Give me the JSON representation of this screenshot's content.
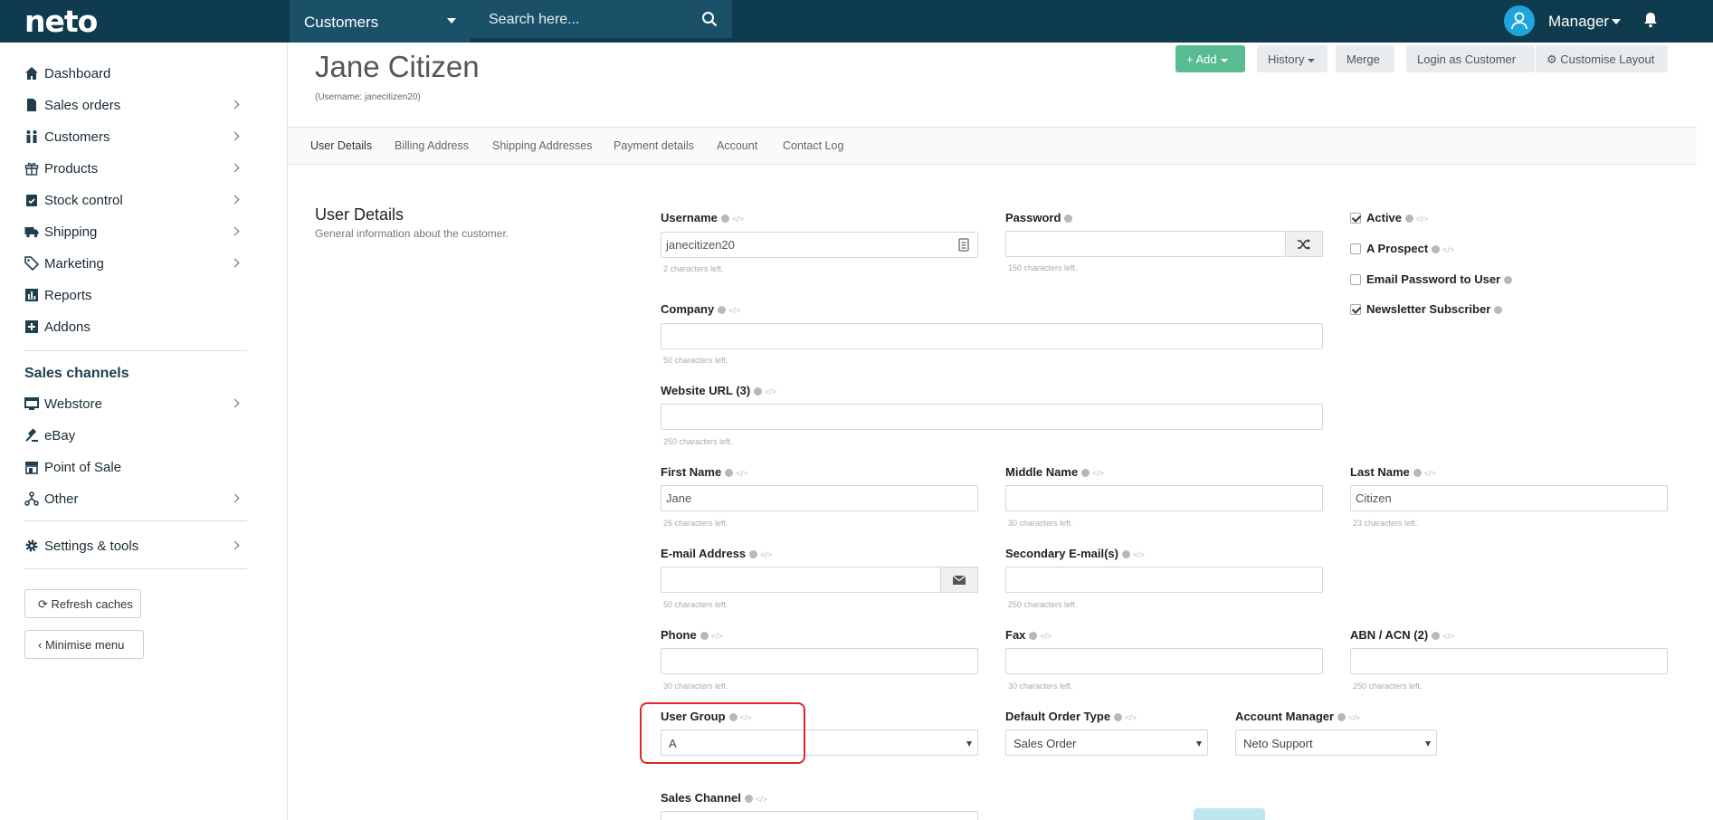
{
  "topbar": {
    "logo": "neto",
    "entity": "Customers",
    "search_placeholder": "Search here...",
    "user": "Manager"
  },
  "sidebar": {
    "items": [
      {
        "label": "Dashboard",
        "icon": "home-icon"
      },
      {
        "label": "Sales orders",
        "icon": "document-icon"
      },
      {
        "label": "Customers",
        "icon": "people-icon"
      },
      {
        "label": "Products",
        "icon": "gift-icon"
      },
      {
        "label": "Stock control",
        "icon": "clipboard-icon"
      },
      {
        "label": "Shipping",
        "icon": "truck-icon"
      },
      {
        "label": "Marketing",
        "icon": "tag-icon"
      },
      {
        "label": "Reports",
        "icon": "bar-chart-icon"
      },
      {
        "label": "Addons",
        "icon": "plus-square-icon"
      }
    ],
    "channels_title": "Sales channels",
    "channels": [
      {
        "label": "Webstore",
        "icon": "monitor-icon"
      },
      {
        "label": "eBay",
        "icon": "gavel-icon"
      },
      {
        "label": "Point of Sale",
        "icon": "store-icon"
      },
      {
        "label": "Other",
        "icon": "fork-icon"
      }
    ],
    "settings": "Settings & tools",
    "refresh": "Refresh caches",
    "minimise": "Minimise menu"
  },
  "header": {
    "title": "Jane Citizen",
    "subtitle": "(Username: janecitizen20)",
    "add": "Add",
    "history": "History",
    "merge": "Merge",
    "login_as": "Login as Customer",
    "customise": "Customise Layout"
  },
  "tabs": [
    "User Details",
    "Billing Address",
    "Shipping Addresses",
    "Payment details",
    "Account",
    "Contact Log"
  ],
  "form": {
    "section_title": "User Details",
    "section_desc": "General information about the customer.",
    "username_label": "Username",
    "username_value": "janecitizen20",
    "username_hint": "2 characters left.",
    "password_label": "Password",
    "password_hint": "150 characters left.",
    "active_label": "Active",
    "prospect_label": "A Prospect",
    "email_pw_label": "Email Password to User",
    "newsletter_label": "Newsletter Subscriber",
    "company_label": "Company",
    "company_hint": "50 characters left.",
    "website_label": "Website URL (3)",
    "website_hint": "250 characters left.",
    "first_label": "First Name",
    "first_value": "Jane",
    "first_hint": "26 characters left.",
    "middle_label": "Middle Name",
    "middle_hint": "30 characters left.",
    "last_label": "Last Name",
    "last_value": "Citizen",
    "last_hint": "23 characters left.",
    "email_label": "E-mail Address",
    "email_hint": "50 characters left.",
    "secondary_label": "Secondary E-mail(s)",
    "secondary_hint": "250 characters left.",
    "phone_label": "Phone",
    "phone_hint": "30 characters left.",
    "fax_label": "Fax",
    "fax_hint": "30 characters left.",
    "abn_label": "ABN / ACN (2)",
    "abn_hint": "250 characters left.",
    "group_label": "User Group",
    "group_value": "A",
    "order_type_label": "Default Order Type",
    "order_type_value": "Sales Order",
    "acct_mgr_label": "Account Manager",
    "acct_mgr_value": "Neto Support",
    "channel_label": "Sales Channel"
  },
  "colors": {
    "topbar": "#0f3b4f",
    "accent_green": "#58bb92",
    "highlight": "#e0262c"
  }
}
